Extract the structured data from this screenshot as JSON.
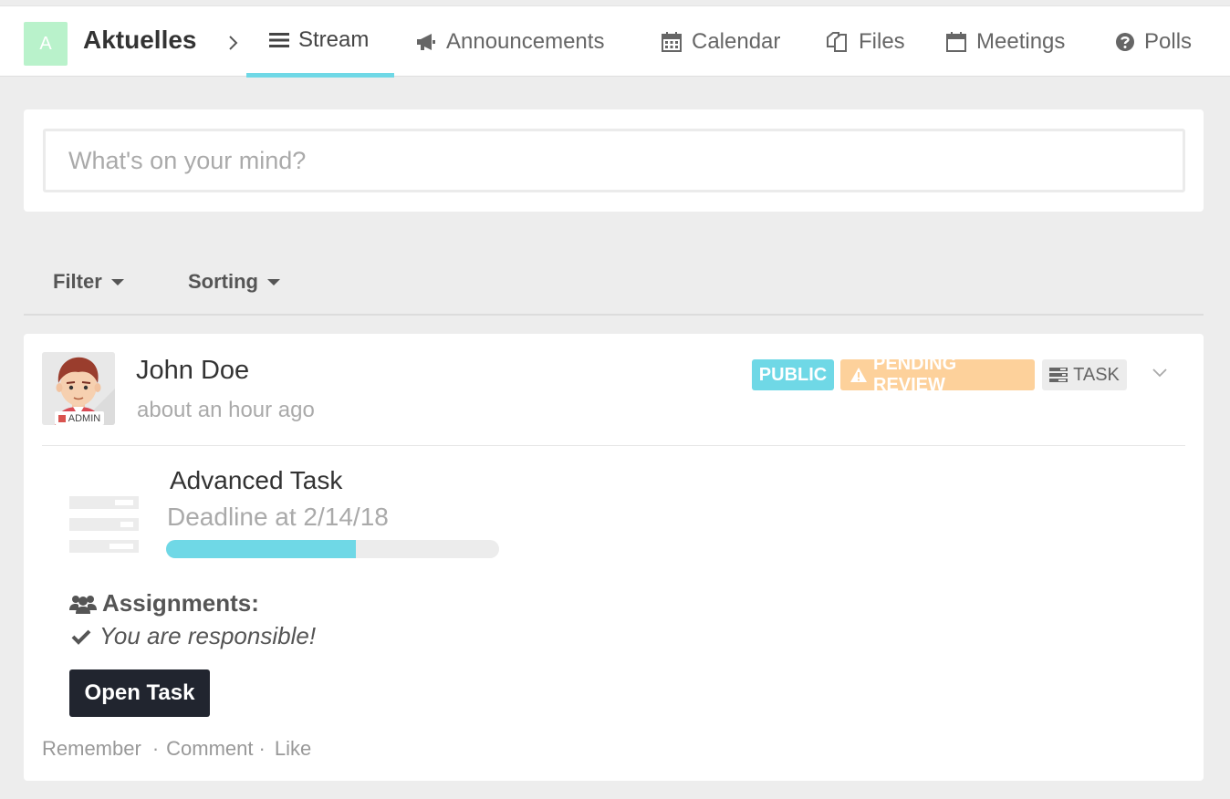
{
  "header": {
    "space_initial": "A",
    "space_name": "Aktuelles",
    "breadcrumb_separator": ">",
    "tabs": [
      {
        "label": "Stream",
        "icon": "list-icon",
        "active": true
      },
      {
        "label": "Announcements",
        "icon": "bullhorn-icon",
        "active": false
      },
      {
        "label": "Calendar",
        "icon": "calendar-icon",
        "active": false
      },
      {
        "label": "Files",
        "icon": "files-icon",
        "active": false
      },
      {
        "label": "Meetings",
        "icon": "calendar-blank-icon",
        "active": false
      },
      {
        "label": "Polls",
        "icon": "question-circle-icon",
        "active": false
      }
    ]
  },
  "composer": {
    "placeholder": "What's on your mind?"
  },
  "filters": {
    "filter_label": "Filter",
    "sorting_label": "Sorting"
  },
  "post": {
    "author": "John Doe",
    "time": "about an hour ago",
    "avatar_badge": "ADMIN",
    "labels": {
      "public": "PUBLIC",
      "pending": "PENDING REVIEW",
      "task": "TASK"
    },
    "task": {
      "title": "Advanced Task",
      "deadline": "Deadline at 2/14/18",
      "progress_percent": 57,
      "assignments_heading": "Assignments:",
      "responsible_text": "You are responsible!",
      "open_button": "Open Task"
    },
    "actions": {
      "remember": "Remember",
      "comment": "Comment",
      "like": "Like"
    }
  },
  "colors": {
    "accent": "#6fd8e6",
    "pending": "#fdd19b",
    "space_icon": "#b9f2cb",
    "button_dark": "#21252f",
    "background": "#ededed"
  }
}
